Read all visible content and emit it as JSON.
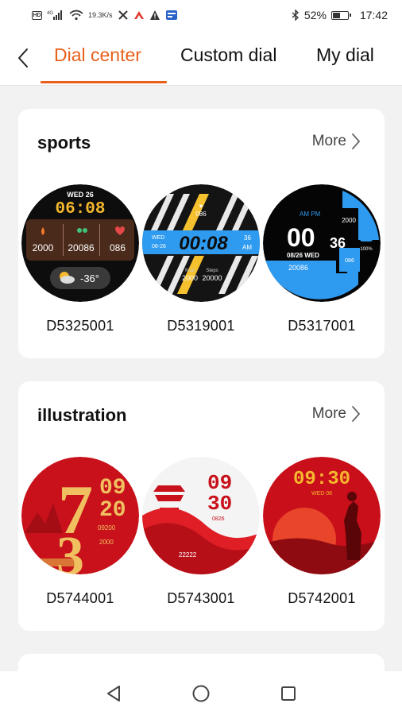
{
  "status_bar": {
    "sim": "HD",
    "net": "4G",
    "speed_value": "19.3",
    "speed_unit": "K/s",
    "battery": "52%",
    "battery_level": 0.52,
    "time": "17:42"
  },
  "header": {
    "tabs": [
      {
        "label": "Dial center",
        "active": true
      },
      {
        "label": "Custom dial",
        "active": false
      },
      {
        "label": "My dial",
        "active": false
      }
    ]
  },
  "sections": [
    {
      "title": "sports",
      "more_label": "More",
      "dials": [
        {
          "code": "D5325001",
          "face": {
            "day": "WED 26",
            "time": "06:08",
            "calories": "2000",
            "steps": "20086",
            "heart": "086",
            "temp": "-36°"
          }
        },
        {
          "code": "D5319001",
          "face": {
            "heart": "086",
            "day": "WED",
            "date": "08-26",
            "time": "00:08",
            "seconds": "36",
            "ampm": "AM",
            "kcal_label": "Kcal",
            "steps_label": "Steps",
            "kcal": "2000",
            "steps": "20000"
          }
        },
        {
          "code": "D5317001",
          "face": {
            "ampm": "AM PM",
            "hours": "00",
            "seconds": "36",
            "date": "08/26 WED",
            "steps": "20086",
            "heart": "086",
            "calories": "2000",
            "percent": "100%"
          }
        }
      ]
    },
    {
      "title": "illustration",
      "more_label": "More",
      "dials": [
        {
          "code": "D5744001",
          "face": {
            "big": "7",
            "big2": "3",
            "hm1": "09",
            "hm2": "20",
            "line1": "09200",
            "line2": "2000"
          }
        },
        {
          "code": "D5743001",
          "face": {
            "hour": "09",
            "minute": "30",
            "small": "0826",
            "stat": "22222"
          }
        },
        {
          "code": "D5742001",
          "face": {
            "time": "09:30",
            "day": "WED 08"
          }
        }
      ]
    }
  ],
  "colors": {
    "accent": "#e8601c",
    "sports_yellow": "#f5b82e",
    "sports_blue": "#2e9bf0",
    "illustration_red": "#c8111b",
    "illustration_gold": "#f0c060"
  },
  "nav": {
    "back_icon": "triangle-back-icon",
    "home_icon": "circle-home-icon",
    "recents_icon": "square-recents-icon"
  }
}
